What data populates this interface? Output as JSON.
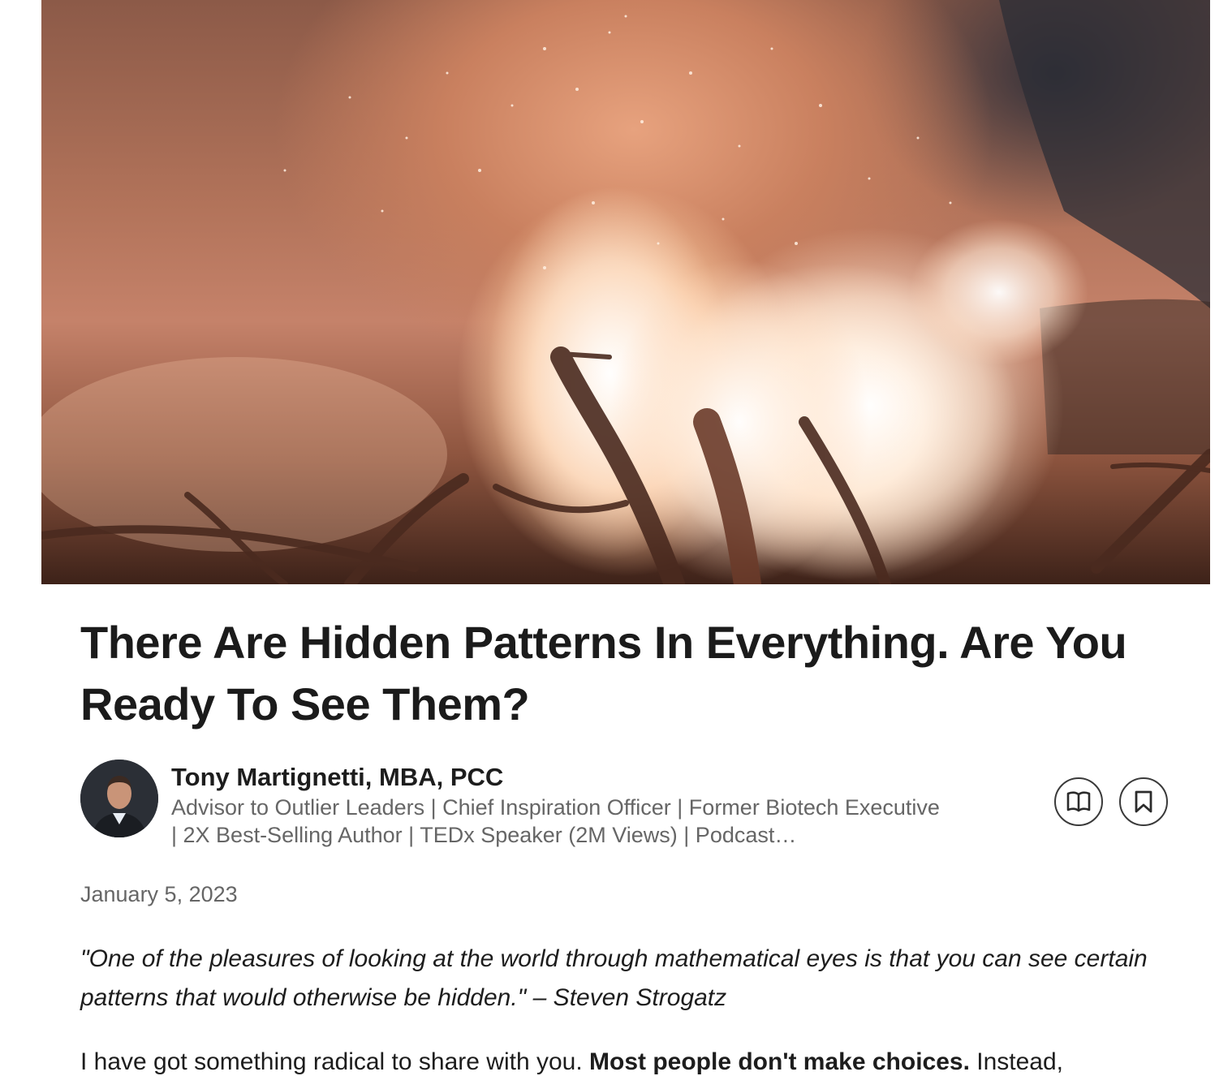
{
  "article": {
    "hero_image": "bonfire-sparks-photo",
    "title": "There Are Hidden Patterns In Everything. Are You Ready To See Them?",
    "date": "January 5, 2023"
  },
  "author": {
    "name": "Tony Martignetti, MBA, PCC",
    "headline": "Advisor to Outlier Leaders | Chief Inspiration Officer | Former Biotech Executive | 2X Best-Selling Author | TEDx Speaker (2M Views) | Podcast…",
    "avatar": "author-photo"
  },
  "actions": {
    "read_icon": "open-book-icon",
    "save_icon": "bookmark-icon"
  },
  "body": {
    "quote": "\"One of the pleasures of looking at the world through mathematical eyes is that you can see certain patterns that would otherwise be hidden.\" – Steven Strogatz",
    "para1_start": "I have got something radical to share with you. ",
    "para1_bold": "Most people don't make choices.",
    "para1_end": " Instead,"
  },
  "colors": {
    "text": "#1d1d1d",
    "muted": "#666666",
    "icon_border": "#3a3a3a"
  }
}
